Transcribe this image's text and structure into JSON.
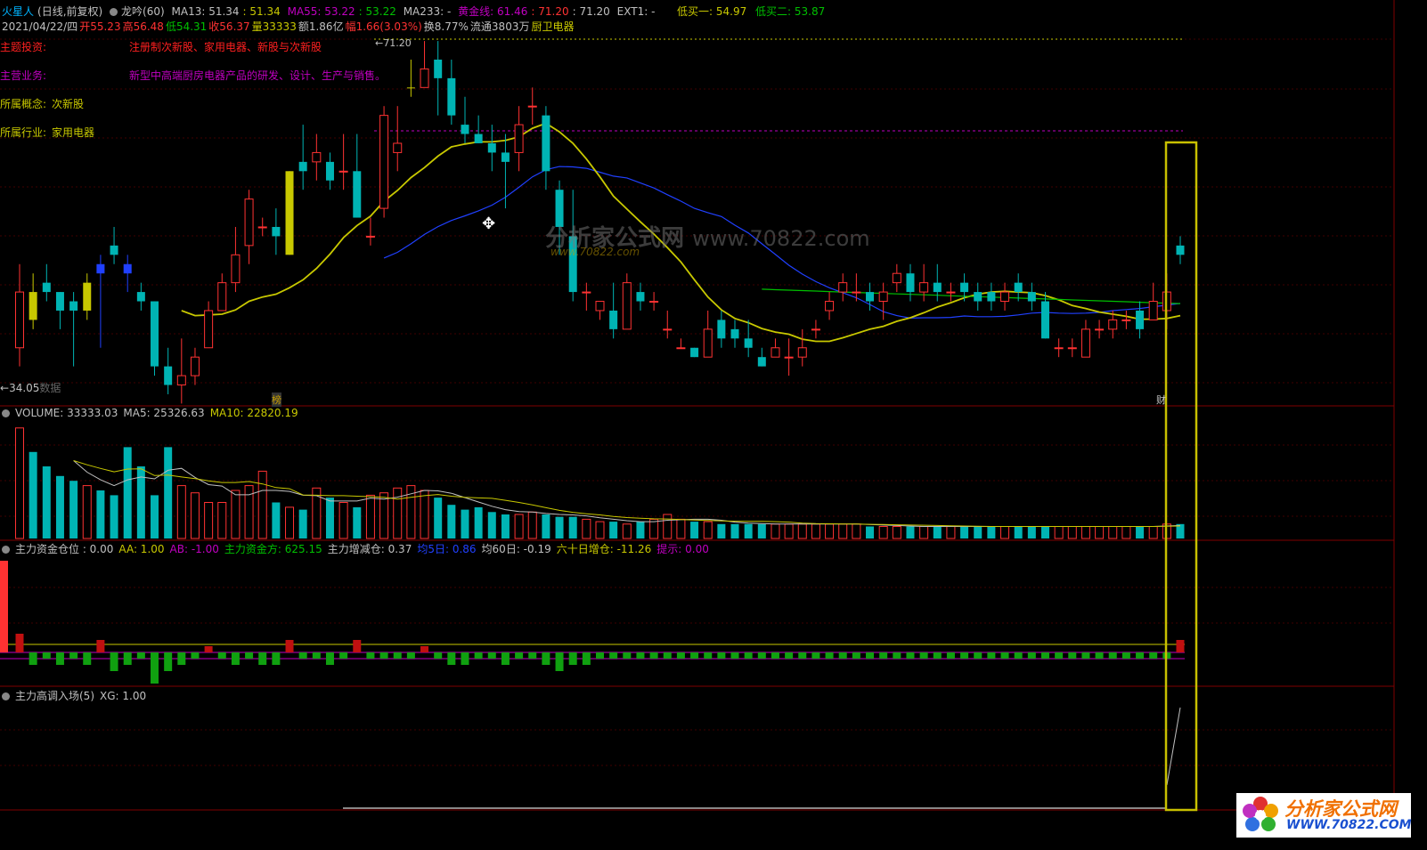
{
  "header1": {
    "name": "火星人",
    "mode": "(日线,前复权)",
    "indicator": "龙吟(60)",
    "ma13": "MA13: 51.34",
    "ma13_val": ": 51.34",
    "ma55": "MA55: 53.22",
    "ma55_val": ": 53.22",
    "ma233": "MA233: -",
    "gold": "黄金线: 61.46",
    "g2": ": 71.20",
    "g3": ": 71.20",
    "ext": "EXT1: -",
    "low1": "低买一: 54.97",
    "low2": "低买二: 53.87"
  },
  "header2": {
    "date": "2021/04/22/四",
    "open": "开55.23",
    "high": "高56.48",
    "low": "低54.31",
    "close": "收56.37",
    "vol": "量33333",
    "amt": "额1.86亿",
    "amp": "幅1.66(3.03%)",
    "turn": "换8.77%",
    "flow": "流通3803万",
    "sector": "厨卫电器"
  },
  "notes": {
    "theme_label": "主题投资:",
    "theme_value": "注册制次新股、家用电器、新股与次新股",
    "biz_label": "主营业务:",
    "biz_value": "新型中高端厨房电器产品的研发、设计、生产与销售。",
    "concept_label": "所属概念:",
    "concept_value": "次新股",
    "industry_label": "所属行业:",
    "industry_value": "家用电器"
  },
  "price_labels": {
    "peak": "71.20",
    "bottom": "34.05",
    "nodata": "数据",
    "marker1": "榜",
    "marker2": "财"
  },
  "volume_head": {
    "title": "VOLUME: 33333.03",
    "ma5": "MA5: 25326.63",
    "ma10": "MA10: 22820.19"
  },
  "ind1_head": {
    "t1": "主力资金仓位 : 0.00",
    "t2": "AA: 1.00",
    "t3": "AB: -1.00",
    "t4": "主力资金方: 625.15",
    "t5": "主力增减仓: 0.37",
    "t6": "均5日: 0.86",
    "t7": "均60日: -0.19",
    "t8": "六十日增仓: -11.26",
    "t9": "提示: 0.00"
  },
  "ind2_head": {
    "t1": "主力高调入场(5)",
    "t2": "XG: 1.00"
  },
  "watermark": {
    "cn": "分析家公式网",
    "url": "WWW.70822.COM",
    "mid_cn": "分析家公式网",
    "mid_url": "www.70822.com",
    "mid_small": "www.70822.com"
  },
  "colors": {
    "up": "#ff3232",
    "down": "#00b4b4",
    "yellow": "#c8c800",
    "blue": "#2040ff",
    "green": "#00c000",
    "magenta": "#c000c0",
    "highlight": "#c8c000"
  },
  "chart_data": {
    "type": "candlestick",
    "candles": [
      [
        38,
        47,
        36,
        44
      ],
      [
        44,
        46,
        40,
        41
      ],
      [
        45,
        47,
        43,
        44
      ],
      [
        44,
        44,
        40,
        42
      ],
      [
        43,
        44,
        36,
        42
      ],
      [
        42,
        46,
        41,
        45
      ],
      [
        47,
        48,
        38,
        46
      ],
      [
        49,
        51,
        47,
        48
      ],
      [
        47,
        48,
        44,
        46
      ],
      [
        44,
        45,
        42,
        43
      ],
      [
        43,
        43,
        35,
        36
      ],
      [
        36,
        38,
        33,
        34
      ],
      [
        34,
        39,
        32,
        35
      ],
      [
        35,
        38,
        34,
        37
      ],
      [
        38,
        43,
        38,
        42
      ],
      [
        42,
        46,
        42,
        45
      ],
      [
        45,
        51,
        44,
        48
      ],
      [
        49,
        55,
        47,
        54
      ],
      [
        51,
        52,
        50,
        51
      ],
      [
        51,
        53,
        48,
        50
      ],
      [
        48,
        57,
        48,
        57
      ],
      [
        58,
        62,
        55,
        57
      ],
      [
        58,
        61,
        56,
        59
      ],
      [
        58,
        59,
        55,
        56
      ],
      [
        57,
        61,
        55,
        57
      ],
      [
        57,
        61,
        52,
        52
      ],
      [
        50,
        52,
        49,
        50
      ],
      [
        53,
        64,
        52,
        63
      ],
      [
        59,
        64,
        57,
        60
      ],
      [
        66,
        69,
        65,
        66
      ],
      [
        66,
        71,
        66,
        68
      ],
      [
        69,
        71,
        63,
        67
      ],
      [
        67,
        69,
        62,
        63
      ],
      [
        62,
        65,
        60,
        61
      ],
      [
        61,
        63,
        60,
        60
      ],
      [
        60,
        62,
        57,
        59
      ],
      [
        59,
        61,
        53,
        58
      ],
      [
        59,
        64,
        57,
        62
      ],
      [
        64,
        66,
        62,
        64
      ],
      [
        63,
        64,
        55,
        57
      ],
      [
        55,
        56,
        48,
        51
      ],
      [
        50,
        55,
        43,
        44
      ],
      [
        44,
        45,
        42,
        44
      ],
      [
        42,
        43,
        41,
        43
      ],
      [
        42,
        45,
        39,
        40
      ],
      [
        40,
        46,
        40,
        45
      ],
      [
        44,
        45,
        42,
        43
      ],
      [
        43,
        44,
        42,
        43
      ],
      [
        40,
        42,
        39,
        40
      ],
      [
        38,
        39,
        38,
        38
      ],
      [
        38,
        38,
        37,
        37
      ],
      [
        37,
        42,
        37,
        40
      ],
      [
        41,
        42,
        38,
        39
      ],
      [
        40,
        41,
        38,
        39
      ],
      [
        39,
        41,
        37,
        38
      ],
      [
        37,
        38,
        36,
        36
      ],
      [
        37,
        39,
        37,
        38
      ],
      [
        37,
        39,
        35,
        37
      ],
      [
        37,
        40,
        36,
        38
      ],
      [
        40,
        41,
        39,
        40
      ],
      [
        42,
        44,
        41,
        43
      ],
      [
        44,
        46,
        43,
        45
      ],
      [
        44,
        46,
        43,
        44
      ],
      [
        44,
        45,
        42,
        43
      ],
      [
        43,
        45,
        41,
        44
      ],
      [
        45,
        47,
        44,
        46
      ],
      [
        46,
        47,
        43,
        44
      ],
      [
        44,
        47,
        43,
        45
      ],
      [
        45,
        47,
        43,
        44
      ],
      [
        44,
        45,
        43,
        44
      ],
      [
        45,
        46,
        43,
        44
      ],
      [
        44,
        45,
        42,
        43
      ],
      [
        44,
        45,
        42,
        43
      ],
      [
        43,
        45,
        42,
        44
      ],
      [
        45,
        46,
        43,
        44
      ],
      [
        44,
        45,
        42,
        43
      ],
      [
        43,
        44,
        39,
        39
      ],
      [
        38,
        39,
        37,
        38
      ],
      [
        38,
        39,
        37,
        38
      ],
      [
        37,
        41,
        37,
        40
      ],
      [
        40,
        41,
        39,
        40
      ],
      [
        40,
        42,
        39,
        41
      ],
      [
        41,
        42,
        40,
        41
      ],
      [
        42,
        43,
        39,
        40
      ],
      [
        41,
        45,
        41,
        43
      ],
      [
        42,
        46,
        40,
        44
      ],
      [
        49,
        50,
        47,
        48
      ]
    ],
    "volume": [
      46,
      36,
      30,
      26,
      24,
      22,
      20,
      18,
      38,
      30,
      18,
      38,
      22,
      19,
      15,
      15,
      20,
      22,
      28,
      15,
      13,
      12,
      21,
      17,
      15,
      13,
      18,
      19,
      21,
      22,
      20,
      17,
      14,
      12,
      13,
      11,
      10,
      10,
      11,
      10,
      9,
      9,
      8,
      7,
      7,
      6,
      7,
      8,
      10,
      8,
      7,
      7,
      6,
      6,
      6,
      6,
      6,
      6,
      6,
      6,
      6,
      6,
      6,
      5,
      5,
      5,
      5,
      5,
      5,
      5,
      5,
      5,
      5,
      5,
      5,
      5,
      5,
      5,
      5,
      5,
      5,
      5,
      5,
      5,
      5,
      6,
      6
    ],
    "indicator_bars": [
      3,
      -2,
      -1,
      -2,
      -1,
      -2,
      2,
      -3,
      -2,
      -1,
      -5,
      -3,
      -2,
      -1,
      1,
      -1,
      -2,
      -1,
      -2,
      -2,
      2,
      -1,
      -1,
      -2,
      -1,
      2,
      -1,
      -1,
      -1,
      -1,
      1,
      -1,
      -2,
      -2,
      -1,
      -1,
      -2,
      -1,
      -1,
      -2,
      -3,
      -2,
      -2,
      -1,
      -1,
      -1,
      -1,
      -1,
      -1,
      -1,
      -1,
      -1,
      -1,
      -1,
      -1,
      -1,
      -1,
      -1,
      -1,
      -1,
      -1,
      -1,
      -1,
      -1,
      -1,
      -1,
      -1,
      -1,
      -1,
      -1,
      -1,
      -1,
      -1,
      -1,
      -1,
      -1,
      -1,
      -1,
      -1,
      -1,
      -1,
      -1,
      -1,
      -1,
      -1,
      -1,
      2
    ],
    "ylim": [
      34.05,
      71.2
    ]
  }
}
